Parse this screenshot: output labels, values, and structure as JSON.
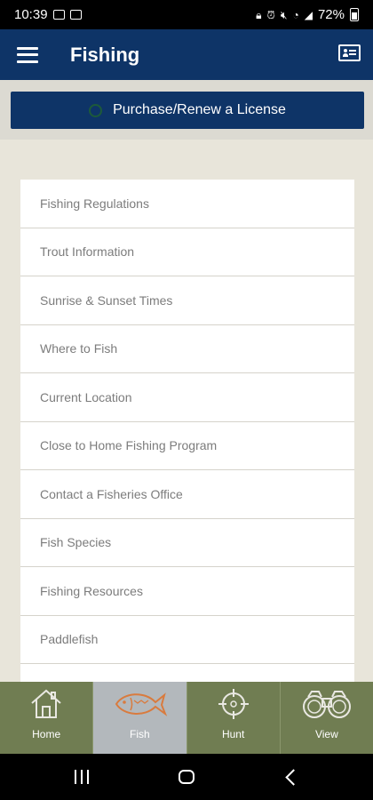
{
  "status_bar": {
    "time": "10:39",
    "battery": "72%"
  },
  "app_bar": {
    "title": "Fishing"
  },
  "purchase_button": {
    "label": "Purchase/Renew a License"
  },
  "menu_items": [
    "Fishing Regulations",
    "Trout Information",
    "Sunrise & Sunset Times",
    "Where to Fish",
    "Current Location",
    "Close to Home Fishing Program",
    "Contact a Fisheries Office",
    "Fish Species",
    "Fishing Resources",
    "Paddlefish"
  ],
  "bottom_nav": {
    "active_tab": "Fish",
    "tabs": [
      {
        "label": "Home",
        "icon": "home-icon"
      },
      {
        "label": "Fish",
        "icon": "fish-icon"
      },
      {
        "label": "Hunt",
        "icon": "crosshair-icon"
      },
      {
        "label": "View",
        "icon": "binoculars-icon"
      }
    ]
  },
  "colors": {
    "app_bar": "#0e3467",
    "bottom_nav": "#707d52",
    "active_tab": "#b3b8bc",
    "fish_icon": "#d97b3e",
    "background": "#e8e5da"
  }
}
